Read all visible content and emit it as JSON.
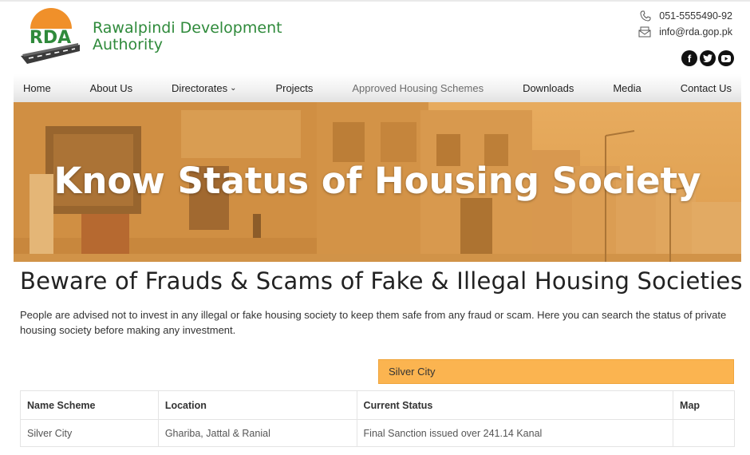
{
  "header": {
    "logo_text": "RDA",
    "org_name": "Rawalpindi Development Authority",
    "phone": "051-5555490-92",
    "email": "info@rda.gop.pk",
    "socials": [
      {
        "name": "facebook",
        "glyph": "f"
      },
      {
        "name": "twitter",
        "glyph": "t"
      },
      {
        "name": "youtube",
        "glyph": "▶"
      }
    ]
  },
  "nav": {
    "items": [
      {
        "label": "Home"
      },
      {
        "label": "About Us"
      },
      {
        "label": "Directorates",
        "has_dropdown": true
      },
      {
        "label": "Projects"
      },
      {
        "label": "Approved Housing Schemes",
        "active": true
      },
      {
        "label": "Downloads"
      },
      {
        "label": "Media"
      },
      {
        "label": "Contact Us"
      }
    ]
  },
  "hero": {
    "title": "Know Status of Housing Society",
    "overlay_color": "#e8a24a"
  },
  "content": {
    "warning_title": "Beware of Frauds & Scams of Fake & Illegal Housing Societies",
    "intro": "People are advised not to invest in any illegal or fake housing society to keep them safe from any fraud or scam. Here you can search the status of private housing society before making any investment."
  },
  "search": {
    "selected": "Silver City"
  },
  "table": {
    "headers": [
      "Name Scheme",
      "Location",
      "Current Status",
      "Map"
    ],
    "rows": [
      [
        "Silver City",
        "Ghariba, Jattal & Ranial",
        "Final Sanction issued over 241.14 Kanal",
        ""
      ]
    ]
  },
  "colors": {
    "brand_green": "#2f8a3b",
    "brand_orange": "#f0902a",
    "accent": "#fbb450"
  }
}
